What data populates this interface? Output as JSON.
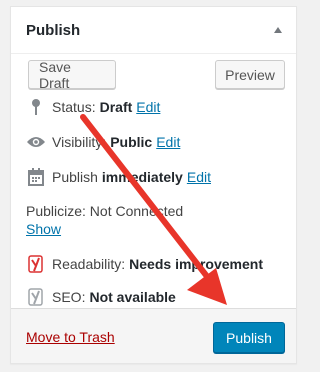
{
  "header": {
    "title": "Publish"
  },
  "actions": {
    "save_draft": "Save Draft",
    "preview": "Preview"
  },
  "status": {
    "label": "Status:",
    "value": "Draft",
    "edit": "Edit"
  },
  "visibility": {
    "label": "Visibility:",
    "value": "Public",
    "edit": "Edit"
  },
  "publish_time": {
    "label": "Publish",
    "value": "immediately",
    "edit": "Edit"
  },
  "publicize": {
    "text": "Publicize: Not Connected",
    "show": "Show"
  },
  "readability": {
    "label": "Readability:",
    "value": "Needs improvement"
  },
  "seo": {
    "label": "SEO:",
    "value": "Not available"
  },
  "footer": {
    "trash": "Move to Trash",
    "publish": "Publish"
  },
  "colors": {
    "primary": "#0085ba",
    "link": "#0073aa",
    "trash": "#a00000",
    "arrow": "#e8352a"
  },
  "icons": [
    "toggle-up-icon",
    "pin-icon",
    "eye-icon",
    "calendar-icon",
    "yoast-red-icon",
    "yoast-gray-icon",
    "annotation-arrow"
  ]
}
